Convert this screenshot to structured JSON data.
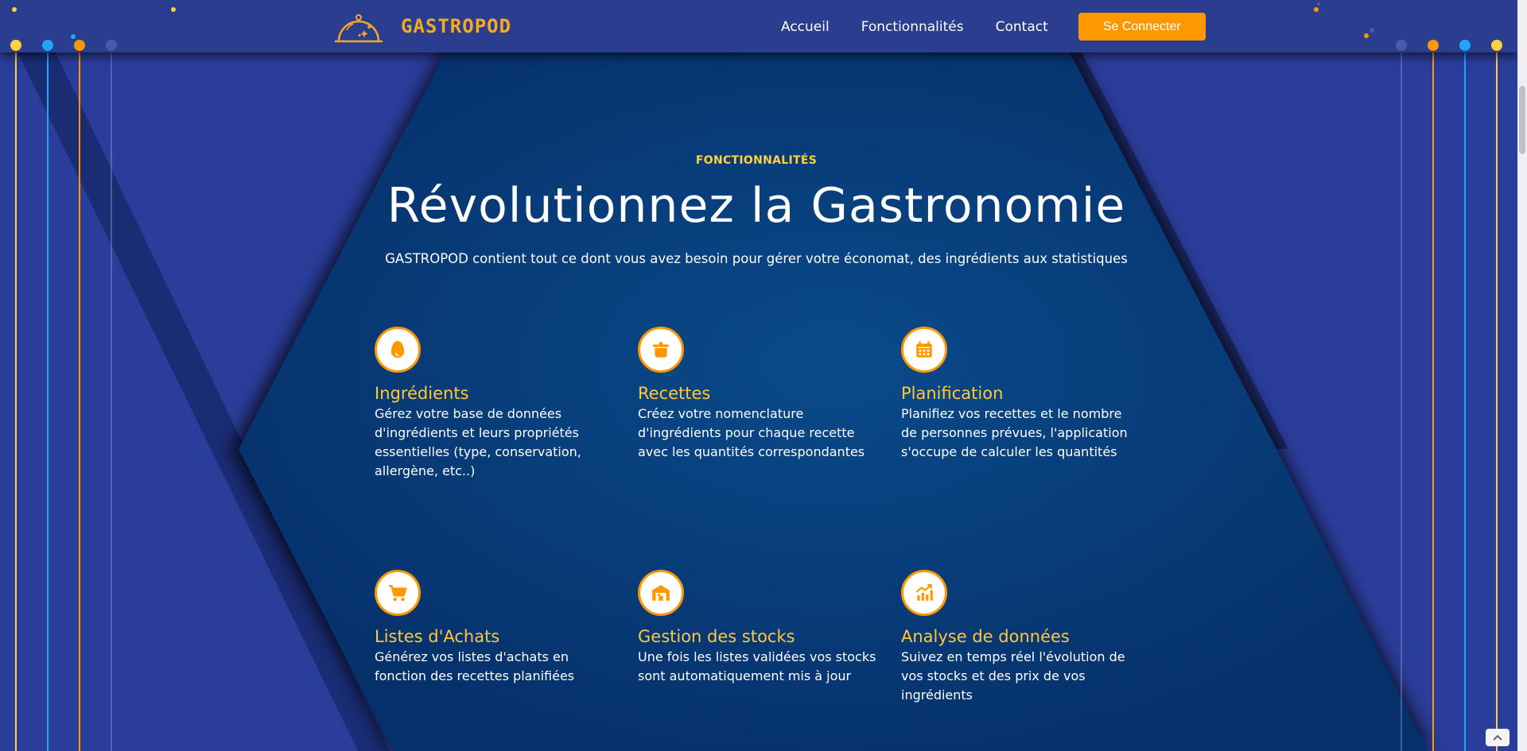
{
  "header": {
    "brand_name": "GASTROPOD",
    "nav_items": [
      "Accueil",
      "Fonctionnalités",
      "Contact"
    ],
    "login_label": "Se Connecter"
  },
  "section": {
    "eyebrow": "FONCTIONNALITÉS",
    "title": "Révolutionnez la Gastronomie",
    "subtitle": "GASTROPOD contient tout ce dont vous avez besoin pour gérer votre économat, des ingrédients aux statistiques"
  },
  "features": [
    {
      "icon": "egg-icon",
      "title": "Ingrédients",
      "text": "Gérez votre base de données d'ingrédients et leurs propriétés essentielles (type, conservation, allergène, etc..)"
    },
    {
      "icon": "cooking-pot-icon",
      "title": "Recettes",
      "text": "Créez votre nomenclature d'ingrédients pour chaque recette avec les quantités correspondantes"
    },
    {
      "icon": "calendar-icon",
      "title": "Planification",
      "text": "Planifiez vos recettes et le nombre de personnes prévues, l'application s'occupe de calculer les quantités"
    },
    {
      "icon": "shopping-cart-icon",
      "title": "Listes d'Achats",
      "text": "Générez vos listes d'achats en fonction des recettes planifiées"
    },
    {
      "icon": "warehouse-icon",
      "title": "Gestion des stocks",
      "text": "Une fois les listes validées vos stocks sont automatiquement mis à jour"
    },
    {
      "icon": "chart-growth-icon",
      "title": "Analyse de données",
      "text": "Suivez en temps réel l'évolution de vos stocks et des prix de vos ingrédients"
    }
  ],
  "colors": {
    "accent": "#ff9800",
    "heading_yellow": "#ffc83a",
    "background_blue": "#2b3d9a",
    "hexagon_navy": "#073a78"
  },
  "back_to_top_icon": "chevron-up-icon"
}
